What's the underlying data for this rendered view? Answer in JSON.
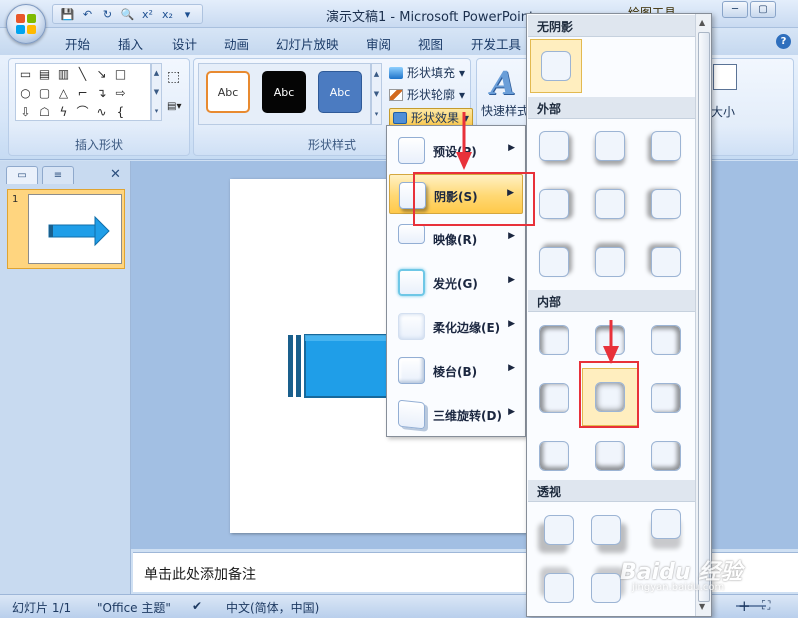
{
  "window": {
    "title": "演示文稿1 - Microsoft PowerPoint",
    "context_tab": "绘图工具",
    "minimize": "─",
    "maximize": "▢",
    "close": "✕"
  },
  "quick_access": [
    "save-icon",
    "undo-icon",
    "redo-icon",
    "preview-icon",
    "superscript-icon",
    "subscript-icon",
    "customize-icon"
  ],
  "quick_access_glyphs": {
    "save": "💾",
    "undo": "↶",
    "redo": "↻",
    "preview": "🔍",
    "superscript": "x²",
    "subscript": "x₂",
    "customize": "▾"
  },
  "tabs": [
    "开始",
    "插入",
    "设计",
    "动画",
    "幻灯片放映",
    "审阅",
    "视图",
    "开发工具"
  ],
  "ribbon": {
    "insert_shapes_label": "插入形状",
    "shape_styles_label": "形状样式",
    "style_sample": "Abc",
    "shape_fill": "形状填充",
    "shape_outline": "形状轮廓",
    "shape_effects": "形状效果",
    "quick_styles": "快速样式",
    "size": "大小",
    "dropdown_glyph": "▾"
  },
  "slides_pane": {
    "slide_number": "1",
    "close_glyph": "✕"
  },
  "notes_placeholder": "单击此处添加备注",
  "status": {
    "slide_counter": "幻灯片 1/1",
    "theme": "\"Office 主题\"",
    "language": "中文(简体，中国)",
    "zoom_in": "+"
  },
  "effects_menu": [
    {
      "label": "预设(P)",
      "icon": "preset-icon",
      "active": false
    },
    {
      "label": "阴影(S)",
      "icon": "shadow-icon",
      "active": true
    },
    {
      "label": "映像(R)",
      "icon": "reflection-icon",
      "active": false
    },
    {
      "label": "发光(G)",
      "icon": "glow-icon",
      "active": false
    },
    {
      "label": "柔化边缘(E)",
      "icon": "soft-edges-icon",
      "active": false
    },
    {
      "label": "棱台(B)",
      "icon": "bevel-icon",
      "active": false
    },
    {
      "label": "三维旋转(D)",
      "icon": "3d-rotation-icon",
      "active": false
    }
  ],
  "shadow_gallery": {
    "no_shadow": "无阴影",
    "outer": "外部",
    "inner": "内部",
    "perspective": "透视",
    "selected_inner_index": 4
  },
  "watermark": {
    "text": "Baidu 经验",
    "url": "jingyan.baidu.com"
  },
  "colors": {
    "accent_blue": "#1f9ee8",
    "arrow_dark": "#1a5f8c",
    "highlight_orange": "#ffd873",
    "annotation_red": "#e8313a"
  }
}
